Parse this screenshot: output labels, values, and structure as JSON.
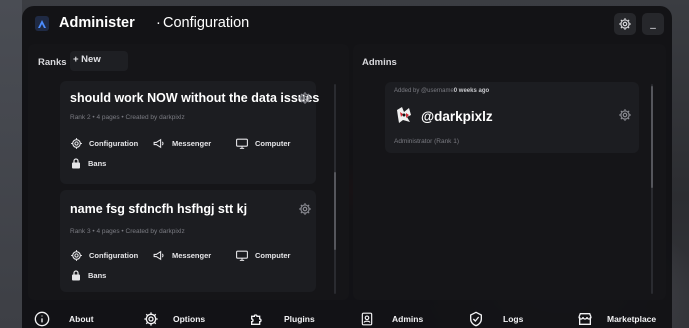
{
  "window": {
    "title_bold": "Administer",
    "title_separator": "·",
    "title_sub": "Configuration",
    "minimize_label": "_"
  },
  "ranks_panel": {
    "label": "Ranks",
    "new_button": "+ New",
    "cards": [
      {
        "title": "should work NOW without the data issues",
        "meta": "Rank 2 • 4 pages • Created by darkpixlz",
        "permissions": [
          "Configuration",
          "Messenger",
          "Computer",
          "Bans"
        ]
      },
      {
        "title": "name fsg sfdncfh hsfhgj stt kj",
        "meta": "Rank 3 • 4 pages • Created by darkpixlz",
        "permissions": [
          "Configuration",
          "Messenger",
          "Computer",
          "Bans"
        ]
      }
    ]
  },
  "admins_panel": {
    "label": "Admins",
    "cards": [
      {
        "added_prefix": "Added by @username",
        "added_time": "0 weeks ago",
        "name": "@darkpixlz",
        "role": "Administrator (Rank 1)"
      }
    ]
  },
  "bottom_nav": [
    {
      "label": "About",
      "icon": "info-icon"
    },
    {
      "label": "Options",
      "icon": "gear-icon"
    },
    {
      "label": "Plugins",
      "icon": "puzzle-icon"
    },
    {
      "label": "Admins",
      "icon": "admin-icon"
    },
    {
      "label": "Logs",
      "icon": "shield-check-icon"
    },
    {
      "label": "Marketplace",
      "icon": "store-icon"
    }
  ],
  "colors": {
    "window_bg": "#101013",
    "panel_bg": "#151518",
    "card_bg": "#1c1d21",
    "text": "#ffffff",
    "muted": "#7a7b82"
  }
}
